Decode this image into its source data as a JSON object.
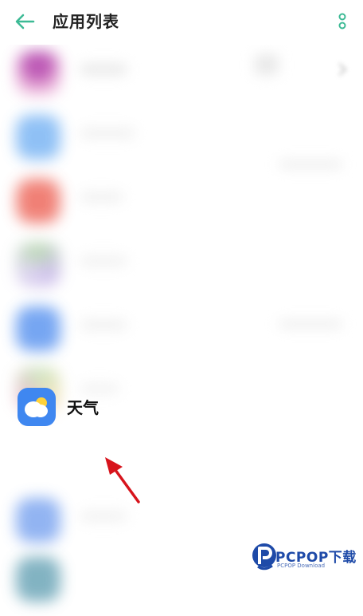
{
  "header": {
    "title": "应用列表",
    "back_icon": "arrow-left-icon",
    "more_icon": "more-vertical-icon",
    "accent_color": "#3dba95"
  },
  "apps": {
    "highlighted": {
      "label": "天气",
      "icon": "weather-cloud-sun-icon",
      "icon_color": "#3f87f0"
    },
    "annotation": {
      "icon": "red-arrow-icon",
      "color": "#d7141c"
    }
  },
  "watermark": {
    "text": "PCPOP下载",
    "sub": "PCPOP Download"
  }
}
